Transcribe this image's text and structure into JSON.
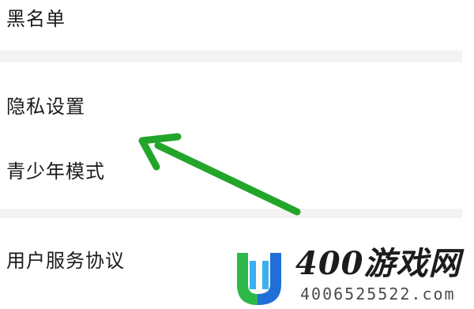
{
  "settings": {
    "items": [
      {
        "label": "黑名单"
      },
      {
        "label": "隐私设置"
      },
      {
        "label": "青少年模式"
      },
      {
        "label": "用户服务协议"
      }
    ]
  },
  "annotation": {
    "arrow_color": "#22a52a",
    "points_to": "隐私设置"
  },
  "watermark": {
    "title": "400游戏网",
    "phone": "4006525522.com",
    "logo_colors": [
      "#2fb84a",
      "#1f6fd6",
      "#3ab0f0"
    ]
  }
}
